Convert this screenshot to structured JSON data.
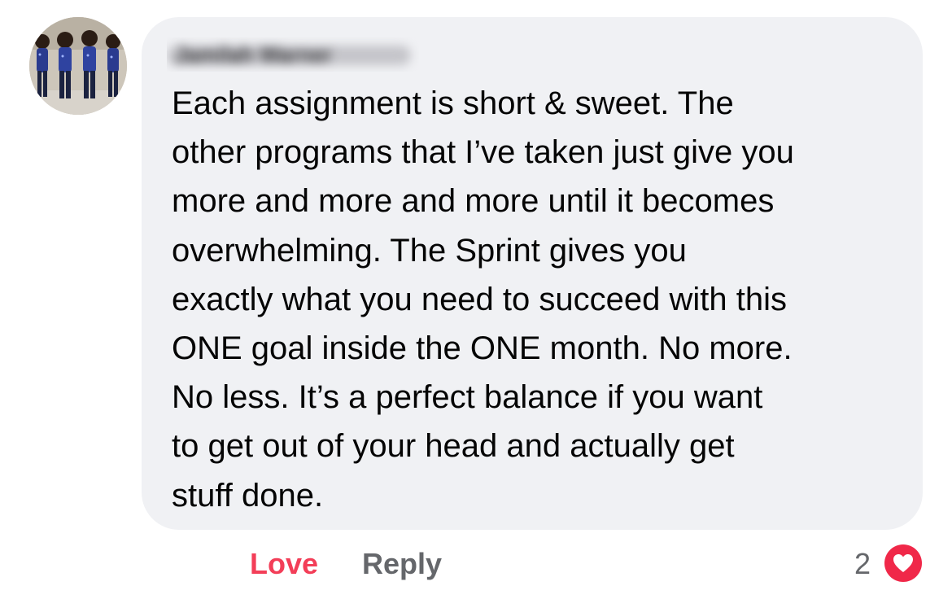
{
  "comment": {
    "author_name": "Jamilah Warner",
    "text": "Each assignment is short & sweet. The\nother programs that I’ve taken just give you\nmore and more and more until it becomes\noverwhelming. The Sprint gives you\nexactly what you need to succeed with this\nONE goal inside the ONE month. No more.\nNo less. It’s a perfect balance if you want\nto get out of your head and actually get\nstuff done."
  },
  "actions": {
    "love_label": "Love",
    "reply_label": "Reply"
  },
  "reactions": {
    "count": "2",
    "icon": "heart-icon",
    "color": "#f02849"
  },
  "colors": {
    "bubble": "#f0f1f4",
    "love_active": "#f33e58",
    "secondary_text": "#65676b"
  }
}
